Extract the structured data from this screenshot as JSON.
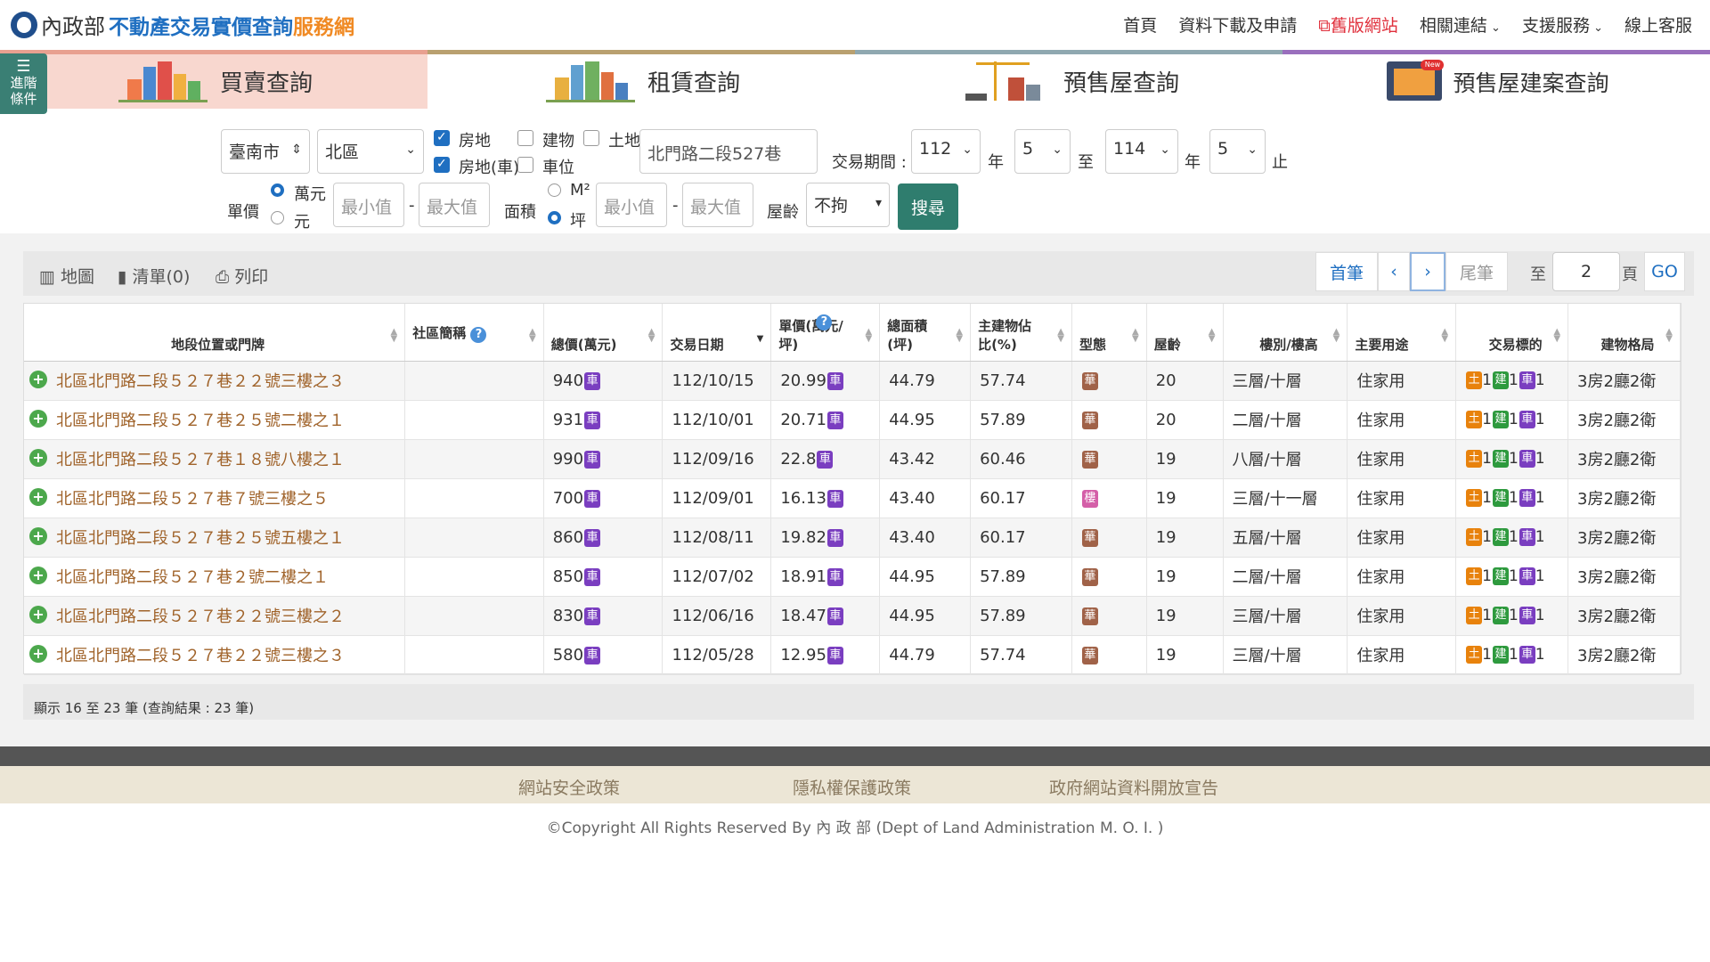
{
  "header": {
    "ministry": "內政部",
    "title_blue": "不動產交易實價查詢",
    "title_orange": "服務網",
    "nav": [
      "首頁",
      "資料下載及申請",
      "舊版網站",
      "相關連結",
      "支援服務",
      "線上客服"
    ]
  },
  "advanced": {
    "label": "進階條件"
  },
  "tabs": [
    "買賣查詢",
    "租賃查詢",
    "預售屋查詢",
    "預售屋建案查詢"
  ],
  "tab_new_badge": "New",
  "filter": {
    "city": "臺南市",
    "district": "北區",
    "cb_fangdi": "房地",
    "cb_fangdi_car": "房地(車)",
    "cb_jianwu": "建物",
    "cb_chewei": "車位",
    "cb_tudi": "土地",
    "keyword": "北門路二段527巷",
    "period_label": "交易期間 :",
    "year_from": "112",
    "month_from": "5",
    "to_label": "至",
    "year_to": "114",
    "month_to": "5",
    "end_label": "止",
    "year_unit": "年",
    "unit_price_label": "單價",
    "unit_wan": "萬元",
    "unit_yuan": "元",
    "min_placeholder": "最小值",
    "max_placeholder": "最大值",
    "dash": "-",
    "area_label": "面積",
    "area_m2": "M²",
    "area_ping": "坪",
    "age_label": "屋齡",
    "age_value": "不拘",
    "search_button": "搜尋"
  },
  "toolbar": {
    "map": "地圖",
    "list": "清單(0)",
    "print": "列印",
    "first": "首筆",
    "prev": "‹",
    "next": "›",
    "last": "尾筆",
    "to_label": "至",
    "page_value": "2",
    "page_unit": "頁",
    "go": "GO"
  },
  "table": {
    "headers": [
      "地段位置或門牌",
      "社區簡稱",
      "總價(萬元)",
      "交易日期",
      "單價(萬元/坪)",
      "總面積(坪)",
      "主建物佔比(%)",
      "型態",
      "屋齡",
      "樓別/樓高",
      "主要用途",
      "交易標的",
      "建物格局"
    ],
    "rows": [
      {
        "addr": "北區北門路二段５２７巷２２號三樓之３",
        "price": "940",
        "date": "112/10/15",
        "unit": "20.99",
        "area": "44.79",
        "ratio": "57.74",
        "type": "華",
        "age": "20",
        "floor": "三層/十層",
        "use": "住家用",
        "layout": "3房2廳2衛"
      },
      {
        "addr": "北區北門路二段５２７巷２５號二樓之１",
        "price": "931",
        "date": "112/10/01",
        "unit": "20.71",
        "area": "44.95",
        "ratio": "57.89",
        "type": "華",
        "age": "20",
        "floor": "二層/十層",
        "use": "住家用",
        "layout": "3房2廳2衛"
      },
      {
        "addr": "北區北門路二段５２７巷１８號八樓之１",
        "price": "990",
        "date": "112/09/16",
        "unit": "22.8",
        "area": "43.42",
        "ratio": "60.46",
        "type": "華",
        "age": "19",
        "floor": "八層/十層",
        "use": "住家用",
        "layout": "3房2廳2衛"
      },
      {
        "addr": "北區北門路二段５２７巷７號三樓之５",
        "price": "700",
        "date": "112/09/01",
        "unit": "16.13",
        "area": "43.40",
        "ratio": "60.17",
        "type": "樓",
        "age": "19",
        "floor": "三層/十一層",
        "use": "住家用",
        "layout": "3房2廳2衛"
      },
      {
        "addr": "北區北門路二段５２７巷２５號五樓之１",
        "price": "860",
        "date": "112/08/11",
        "unit": "19.82",
        "area": "43.40",
        "ratio": "60.17",
        "type": "華",
        "age": "19",
        "floor": "五層/十層",
        "use": "住家用",
        "layout": "3房2廳2衛"
      },
      {
        "addr": "北區北門路二段５２７巷２號二樓之１",
        "price": "850",
        "date": "112/07/02",
        "unit": "18.91",
        "area": "44.95",
        "ratio": "57.89",
        "type": "華",
        "age": "19",
        "floor": "二層/十層",
        "use": "住家用",
        "layout": "3房2廳2衛"
      },
      {
        "addr": "北區北門路二段５２７巷２２號三樓之２",
        "price": "830",
        "date": "112/06/16",
        "unit": "18.47",
        "area": "44.95",
        "ratio": "57.89",
        "type": "華",
        "age": "19",
        "floor": "三層/十層",
        "use": "住家用",
        "layout": "3房2廳2衛"
      },
      {
        "addr": "北區北門路二段５２７巷２２號三樓之３",
        "price": "580",
        "date": "112/05/28",
        "unit": "12.95",
        "area": "44.79",
        "ratio": "57.74",
        "type": "華",
        "age": "19",
        "floor": "三層/十層",
        "use": "住家用",
        "layout": "3房2廳2衛"
      }
    ],
    "badge_car": "車",
    "badge_tu": "土",
    "badge_jian": "建",
    "count_one": "1"
  },
  "status": "顯示 16 至 23 筆 (查詢結果 : 23 筆)",
  "footer": {
    "links": [
      "網站安全政策",
      "隱私權保護政策",
      "政府網站資料開放宣告"
    ],
    "copyright": "©Copyright All Rights Reserved By 內 政 部 (Dept of Land Administration M. O. I. )"
  },
  "colors": {
    "blue": "#1f6fc1",
    "orange": "#f08a24",
    "green_button": "#2f7d6e",
    "address": "#a0632a"
  }
}
